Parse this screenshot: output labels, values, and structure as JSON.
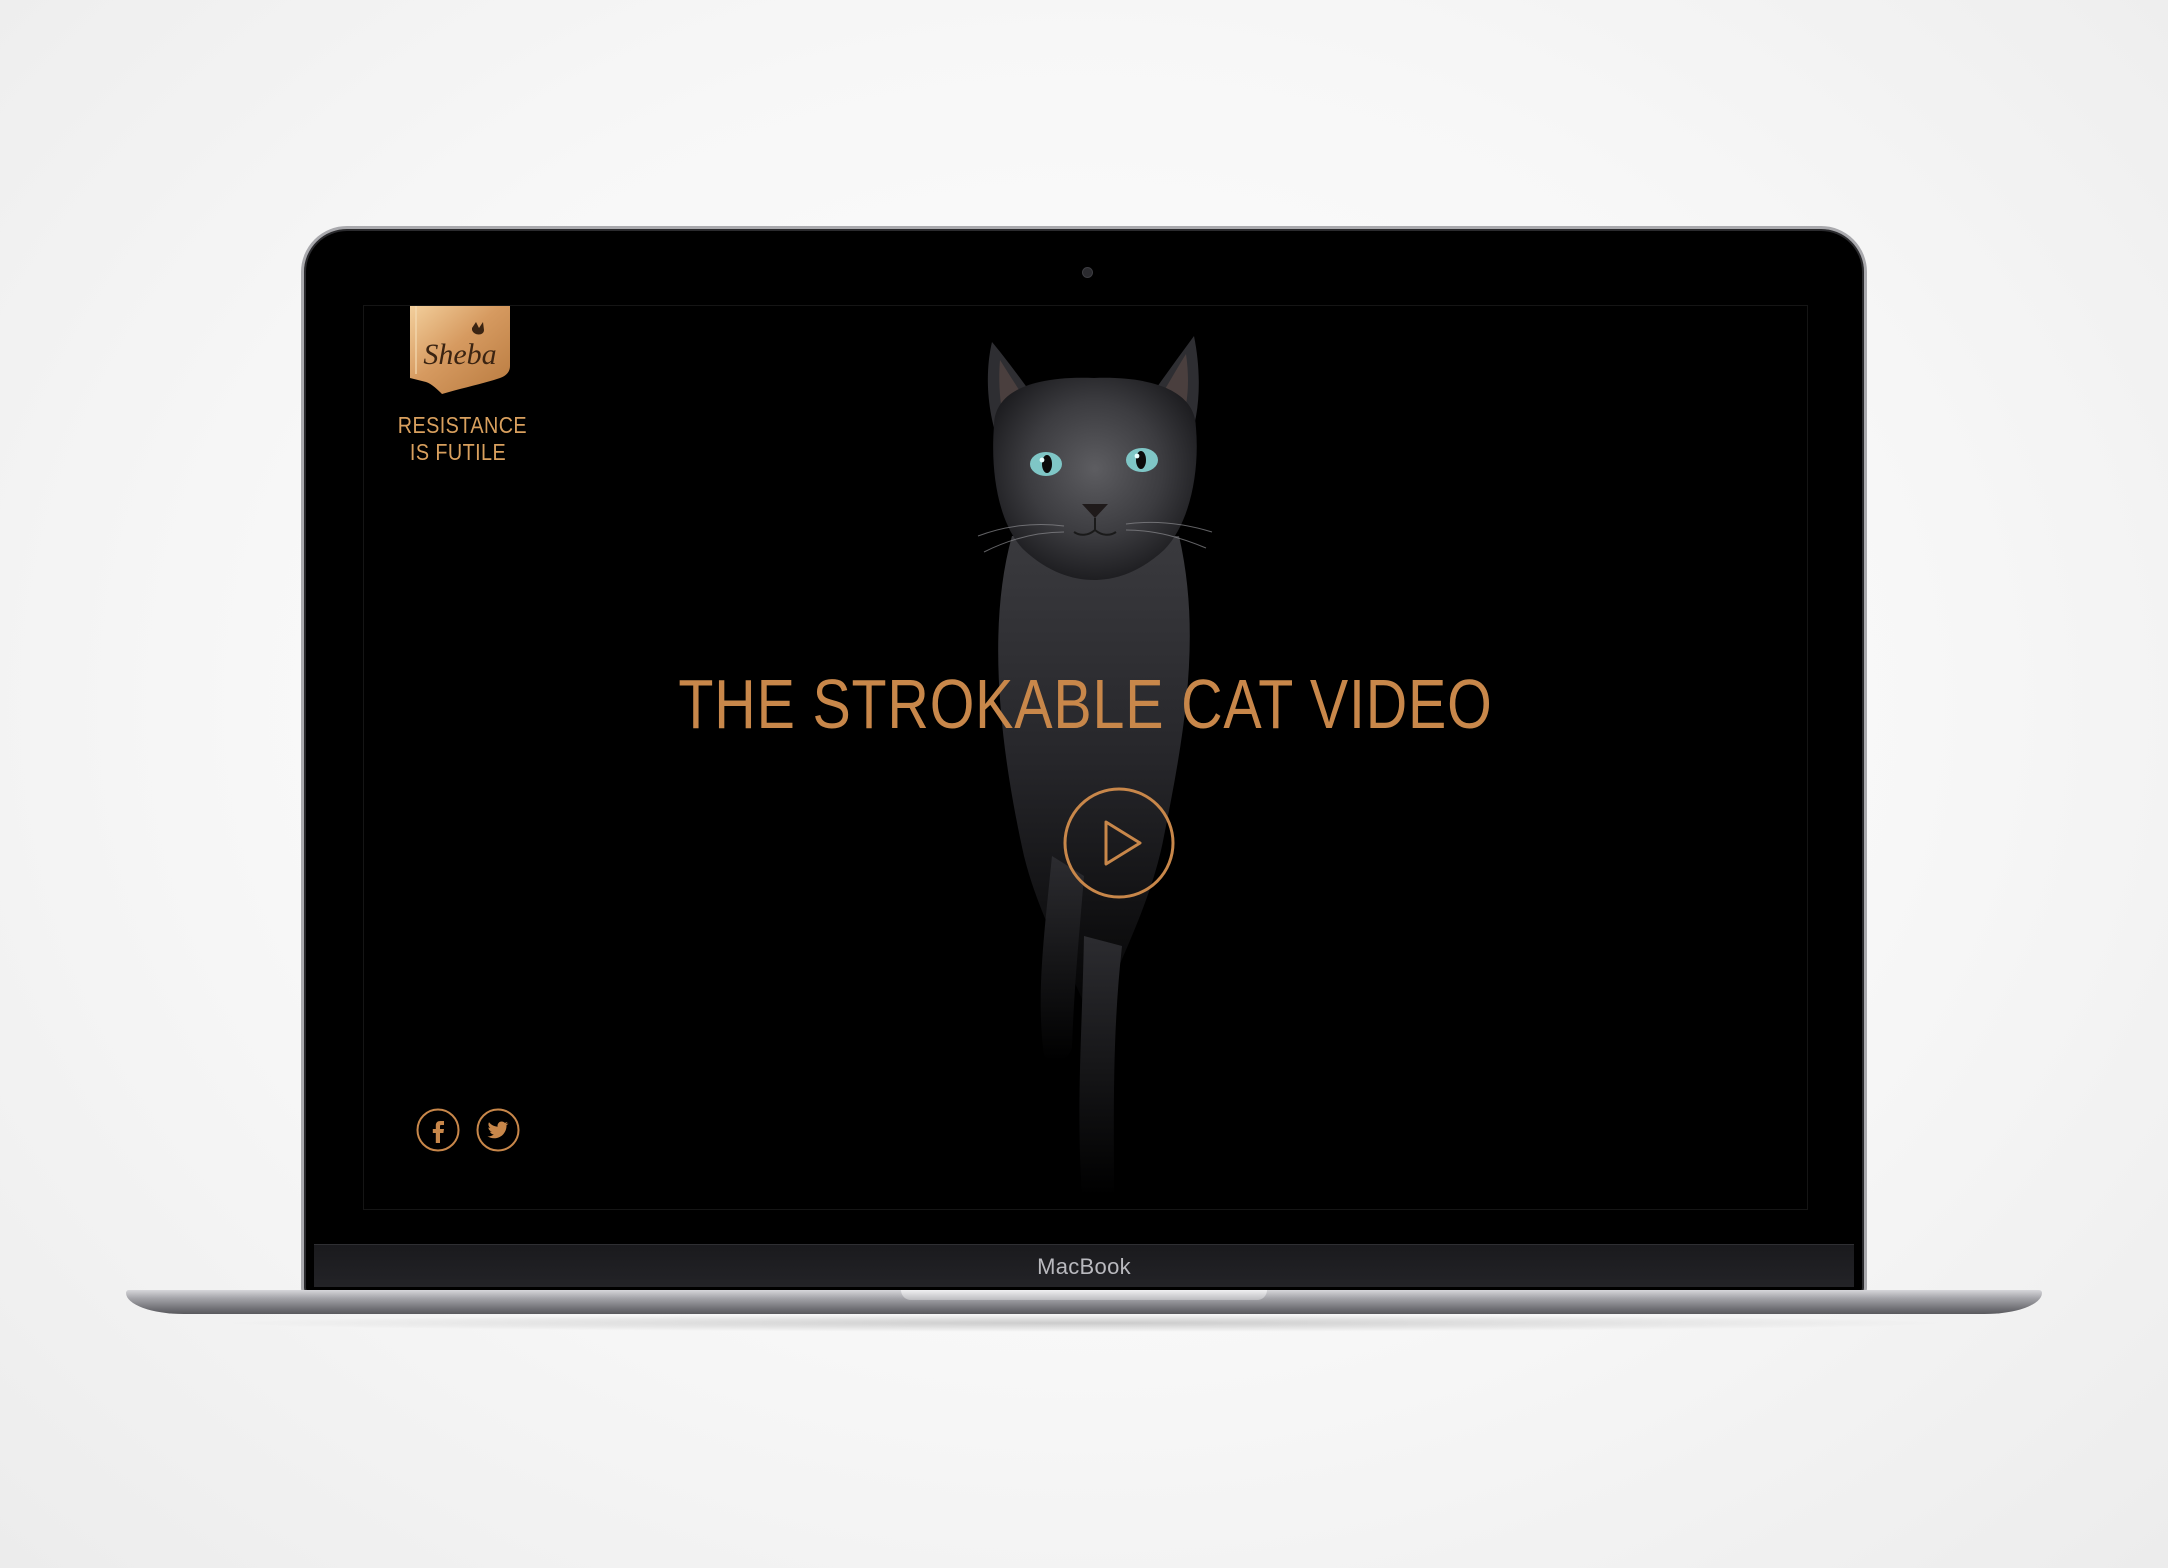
{
  "device": {
    "label": "MacBook"
  },
  "site": {
    "brand": "Sheba",
    "tagline": [
      "RESISTANCE",
      "IS FUTILE"
    ],
    "title": "THE STROKABLE CAT VIDEO"
  },
  "icons": {
    "play": "play-circle-icon",
    "facebook": "facebook-icon",
    "twitter": "twitter-icon"
  },
  "colors": {
    "accent": "#c8874a",
    "tagline": "#d9a05e",
    "background": "#000000"
  }
}
